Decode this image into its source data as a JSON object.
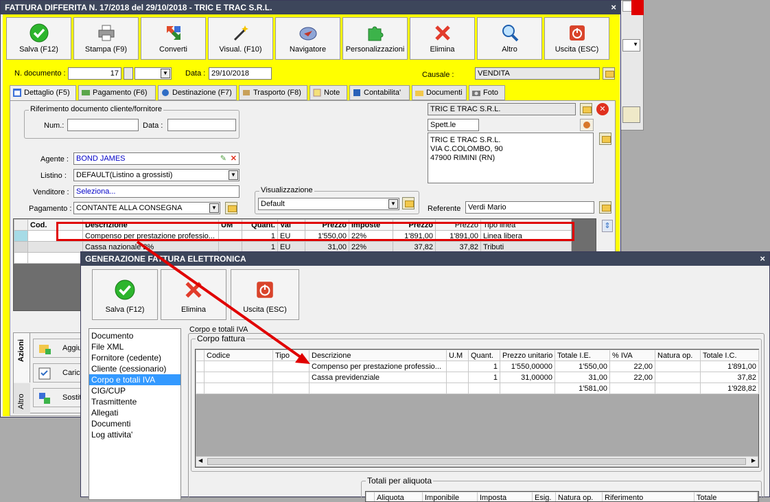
{
  "bg_window": {},
  "main_window": {
    "title": "FATTURA DIFFERITA N. 17/2018 del 29/10/2018 - TRIC E TRAC S.R.L.",
    "close": "×",
    "toolbar": [
      "Salva (F12)",
      "Stampa (F9)",
      "Converti",
      "Visual. (F10)",
      "Navigatore",
      "Personalizzazioni",
      "Elimina",
      "Altro",
      "Uscita (ESC)"
    ],
    "doc_number_label": "N. documento :",
    "doc_number": "17",
    "date_label": "Data :",
    "date": "29/10/2018",
    "causale_label": "Causale :",
    "causale": "VENDITA",
    "tabs": [
      "Dettaglio (F5)",
      "Pagamento (F6)",
      "Destinazione (F7)",
      "Trasporto (F8)",
      "Note",
      "Contabilita'",
      "Documenti",
      "Foto"
    ],
    "rif_group": "Riferimento documento cliente/fornitore",
    "num_label": "Num.:",
    "data_label": "Data :",
    "agente_label": "Agente :",
    "agente": "BOND JAMES",
    "listino_label": "Listino :",
    "listino": "DEFAULT(Listino a grossisti)",
    "venditore_label": "Venditore :",
    "venditore": "Seleziona...",
    "pagamento_label": "Pagamento :",
    "pagamento": "CONTANTE ALLA CONSEGNA",
    "visual_group": "Visualizzazione",
    "visual_value": "Default",
    "client_name": "TRIC E TRAC S.R.L.",
    "spett": "Spett.le",
    "address": [
      "TRIC E TRAC S.R.L.",
      "VIA C.COLOMBO, 90",
      "47900 RIMINI (RN)"
    ],
    "referente_label": "Referente",
    "referente": "Verdi Mario",
    "grid_headers": [
      "Cod.",
      "Descrizione",
      "UM",
      "Quant.",
      "Val",
      "Prezzo",
      "Imposte",
      "Prezzo",
      "Prezzo",
      "Tipo linea"
    ],
    "grid_rows": [
      [
        "",
        "Compenso per prestazione professio...",
        "",
        "1",
        "EU",
        "1'550,00",
        "22%",
        "1'891,00",
        "1'891,00",
        "Linea libera"
      ],
      [
        "",
        "Cassa nazionale 2%",
        "",
        "1",
        "EU",
        "31,00",
        "22%",
        "37,82",
        "37,82",
        "Tributi"
      ]
    ],
    "side_tabs": [
      "Azioni",
      "Altro"
    ],
    "side_buttons": [
      "Aggiungi",
      "Carica",
      "Sostituisci"
    ]
  },
  "e_invoice_window": {
    "title": "GENERAZIONE FATTURA ELETTRONICA",
    "close": "×",
    "buttons": [
      "Salva (F12)",
      "Elimina",
      "Uscita (ESC)"
    ],
    "nav_items": [
      "Documento",
      "File XML",
      "Fornitore (cedente)",
      "Cliente (cessionario)",
      "Corpo e totali IVA",
      "CIG/CUP",
      "Trasmittente",
      "Allegati",
      "Documenti",
      "Log attivita'"
    ],
    "selected_nav": "Corpo e totali IVA",
    "section_title": "Corpo e totali IVA",
    "body_group": "Corpo fattura",
    "body_headers": [
      "Codice",
      "Tipo",
      "Descrizione",
      "U.M",
      "Quant.",
      "Prezzo unitario",
      "Totale I.E.",
      "% IVA",
      "Natura op.",
      "Totale I.C."
    ],
    "body_rows": [
      [
        "",
        "",
        "Compenso per prestazione professio...",
        "",
        "1",
        "1'550,00000",
        "1'550,00",
        "22,00",
        "",
        "1'891,00"
      ],
      [
        "",
        "",
        "Cassa previdenziale",
        "",
        "1",
        "31,00000",
        "31,00",
        "22,00",
        "",
        "37,82"
      ],
      [
        "",
        "",
        "",
        "",
        "",
        "",
        "1'581,00",
        "",
        "",
        "1'928,82"
      ]
    ],
    "totals_group": "Totali per aliquota",
    "totals_headers": [
      "Aliquota",
      "Imponibile",
      "Imposta",
      "Esig.",
      "Natura op.",
      "Riferimento",
      "Totale"
    ]
  },
  "colors": {
    "title_bar": "#3d465b",
    "main_body": "#ffff00",
    "selection": "#3399ff",
    "annotation": "#e00000"
  }
}
